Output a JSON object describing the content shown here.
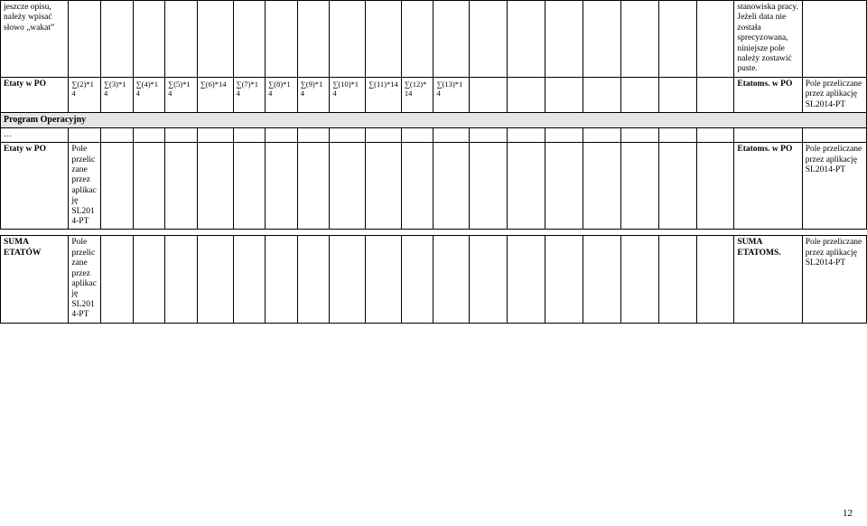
{
  "row1": {
    "label": "jeszcze opisu, należy wpisać słowo „wakat”",
    "c21": "stanowiska pracy. Jeżeli data nie została sprecyzowana, niniejsze pole należy zostawić puste."
  },
  "row2": {
    "label": "Etaty w PO",
    "c2": "∑(2)*14",
    "c3": "∑(3)*14",
    "c4": "∑(4)*14",
    "c5": "∑(5)*14",
    "c6": "∑(6)*14",
    "c7": "∑(7)*14",
    "c8": "∑(8)*14",
    "c9": "∑(9)*14",
    "c10": "∑(10)*14",
    "c11": "∑(11)*14",
    "c12": "∑(12)*14",
    "c13": "∑(13)*14",
    "c21": "Etatoms. w PO",
    "c22": "Pole przeliczane przez aplikację SL2014-PT"
  },
  "sectionA": "Program Operacyjny",
  "ellipsis": "…",
  "row4": {
    "label": "Etaty w PO",
    "c2": "Pole przeliczane przez aplikację SL2014-PT",
    "c21": "Etatoms. w PO",
    "c22": "Pole przeliczane przez aplikację SL2014-PT"
  },
  "row5": {
    "label": "SUMA ETATÓW",
    "c2": "Pole przeliczane przez aplikację SL2014-PT",
    "c21": "SUMA ETATOMS.",
    "c22": "Pole przeliczane przez aplikację SL2014-PT"
  },
  "pagenum": "12"
}
